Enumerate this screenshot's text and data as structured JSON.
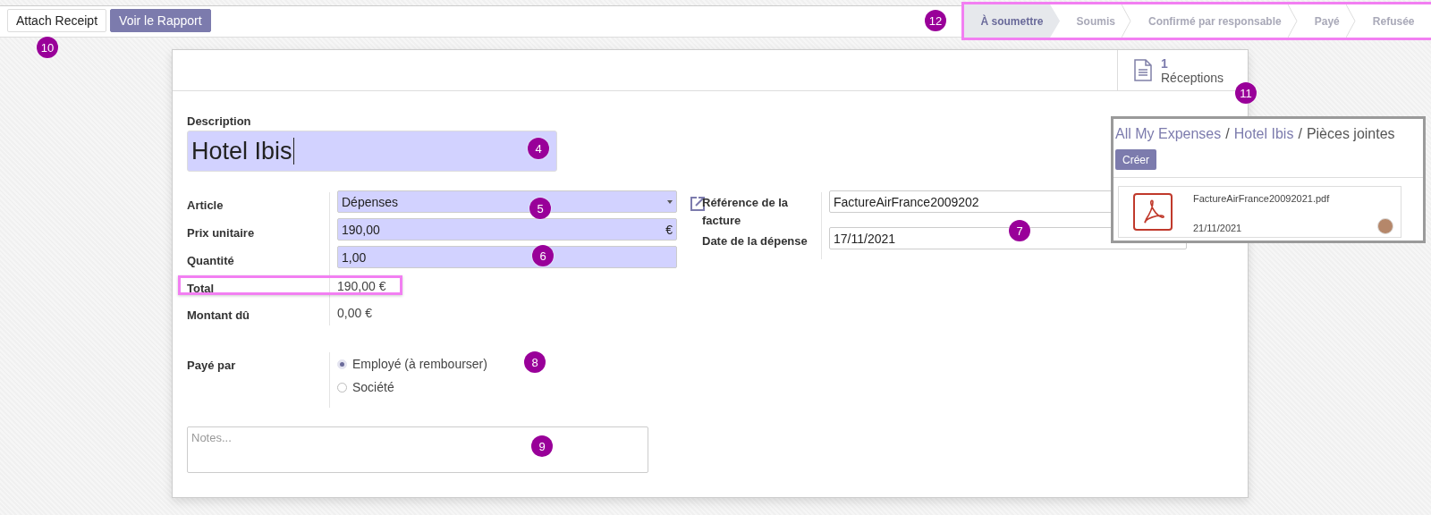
{
  "control_panel": {
    "buttons": [
      {
        "label": "Attach Receipt",
        "kind": "secondary"
      },
      {
        "label": "Voir le Rapport",
        "kind": "primary"
      }
    ],
    "statusbar": {
      "highlighted": true,
      "stages": [
        {
          "label": "À soumettre",
          "selected": true
        },
        {
          "label": "Soumis",
          "selected": false
        },
        {
          "label": "Confirmé par responsable",
          "selected": false
        },
        {
          "label": "Payé",
          "selected": false
        },
        {
          "label": "Refusée",
          "selected": false
        }
      ]
    }
  },
  "sheet": {
    "stat_button": {
      "count": "1",
      "label": "Réceptions"
    },
    "description": {
      "label": "Description",
      "value": "Hotel Ibis"
    },
    "left_fields": [
      {
        "label": "Article",
        "kind": "select",
        "value": "Dépenses"
      },
      {
        "label": "Prix unitaire",
        "kind": "input",
        "value": "190,00",
        "suffix": "€"
      },
      {
        "label": "Quantité",
        "kind": "input",
        "value": "1,00"
      },
      {
        "label": "Total",
        "kind": "readonly",
        "value": "190,00 €",
        "highlighted": true
      },
      {
        "label": "Montant dû",
        "kind": "readonly",
        "value": "0,00 €"
      }
    ],
    "right_fields": [
      {
        "label": "Référence de la facture",
        "kind": "input",
        "value": "FactureAirFrance2009202",
        "external_link": true
      },
      {
        "label": "Date de la dépense",
        "kind": "input",
        "value": "17/11/2021"
      }
    ],
    "paid_by": {
      "label": "Payé par",
      "options": [
        {
          "label": "Employé (à rembourser)",
          "selected": true
        },
        {
          "label": "Société",
          "selected": false
        }
      ]
    },
    "notes": {
      "placeholder": "Notes..."
    }
  },
  "attachments_panel": {
    "breadcrumb": [
      {
        "kind": "link",
        "label": "All My Expenses"
      },
      {
        "kind": "separator",
        "label": "/"
      },
      {
        "kind": "link",
        "label": "Hotel Ibis"
      },
      {
        "kind": "separator",
        "label": "/"
      },
      {
        "kind": "current",
        "label": "Pièces jointes"
      }
    ],
    "create_button": "Créer",
    "files": [
      {
        "name": "FactureAirFrance20092021.pdf",
        "date": "21/11/2021"
      }
    ]
  },
  "annotations": [
    {
      "label": "10"
    },
    {
      "label": "12"
    },
    {
      "label": "11"
    },
    {
      "label": "4"
    },
    {
      "label": "5"
    },
    {
      "label": "6"
    },
    {
      "label": "7"
    },
    {
      "label": "8"
    },
    {
      "label": "9"
    }
  ]
}
